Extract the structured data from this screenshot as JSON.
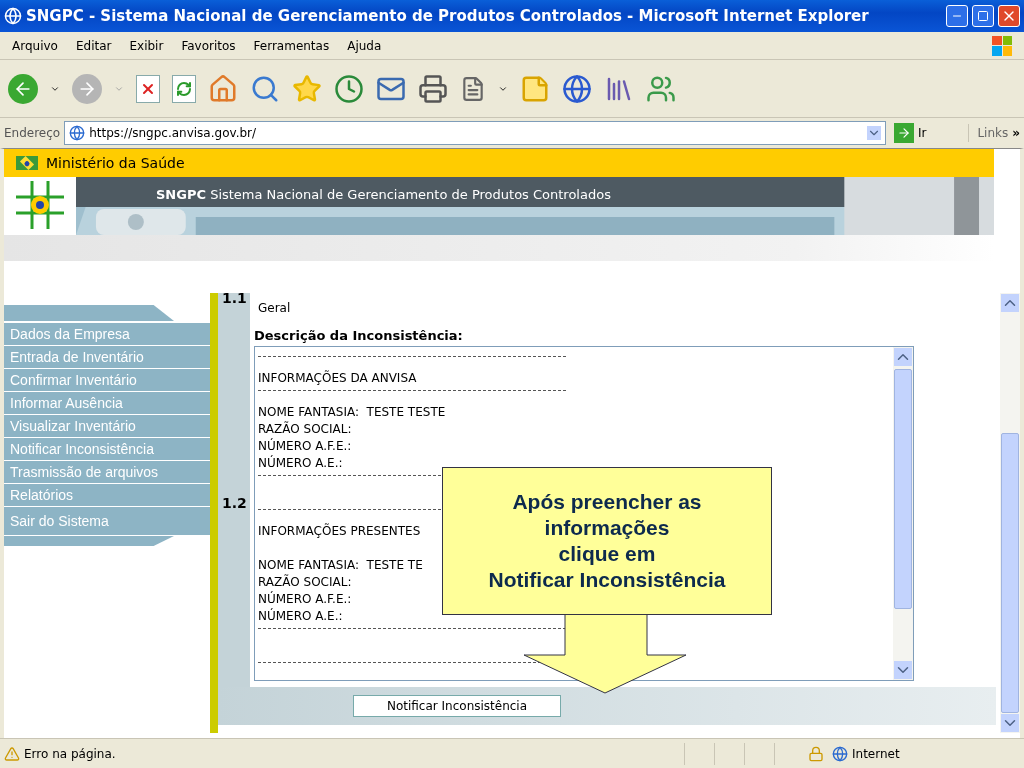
{
  "window": {
    "title": "SNGPC - Sistema Nacional de Gerenciamento de Produtos Controlados - Microsoft Internet Explorer"
  },
  "menu": [
    "Arquivo",
    "Editar",
    "Exibir",
    "Favoritos",
    "Ferramentas",
    "Ajuda"
  ],
  "address_bar": {
    "label": "Endereço",
    "value": "https://sngpc.anvisa.gov.br/",
    "go": "Ir",
    "links": "Links",
    "more": "»"
  },
  "ministry_bar": {
    "title": "Ministério da Saúde"
  },
  "banner": {
    "acronym": "SNGPC",
    "title": "Sistema Nacional de Gerenciamento de Produtos Controlados"
  },
  "sidebar": {
    "items": [
      "Dados da Empresa",
      "Entrada de Inventário",
      "Confirmar Inventário",
      "Informar Ausência",
      "Visualizar Inventário",
      "Notificar Inconsistência",
      "Trasmissão de arquivos",
      "Relatórios",
      "Sair do Sistema"
    ]
  },
  "form": {
    "section_1": {
      "number": "1.1",
      "text": "Geral"
    },
    "section_2": {
      "number": "1.2"
    },
    "heading": "Descrição da Inconsistência:",
    "description_lines": [
      {
        "kind": "separator"
      },
      {
        "kind": "text",
        "text": "INFORMAÇÕES DA ANVISA"
      },
      {
        "kind": "separator"
      },
      {
        "kind": "text",
        "text": "NOME FANTASIA:  TESTE TESTE"
      },
      {
        "kind": "text",
        "text": "RAZÃO SOCIAL:"
      },
      {
        "kind": "text",
        "text": "NÚMERO A.F.E.:"
      },
      {
        "kind": "text",
        "text": "NÚMERO A.E.:"
      },
      {
        "kind": "separator"
      },
      {
        "kind": "blank"
      },
      {
        "kind": "separator"
      },
      {
        "kind": "text",
        "text": "INFORMAÇÕES PRESENTES"
      },
      {
        "kind": "blank"
      },
      {
        "kind": "text",
        "text": "NOME FANTASIA:  TESTE TE"
      },
      {
        "kind": "text",
        "text": "RAZÃO SOCIAL:"
      },
      {
        "kind": "text",
        "text": "NÚMERO A.F.E.:"
      },
      {
        "kind": "text",
        "text": "NÚMERO A.E.:"
      },
      {
        "kind": "separator"
      },
      {
        "kind": "blank"
      },
      {
        "kind": "separator"
      }
    ],
    "submit": "Notificar Inconsistência"
  },
  "callout": {
    "lines": [
      "Após preencher as",
      "informações",
      "clique em",
      "Notificar Inconsistência"
    ]
  },
  "status_bar": {
    "message": "Erro na página.",
    "zone": "Internet"
  }
}
